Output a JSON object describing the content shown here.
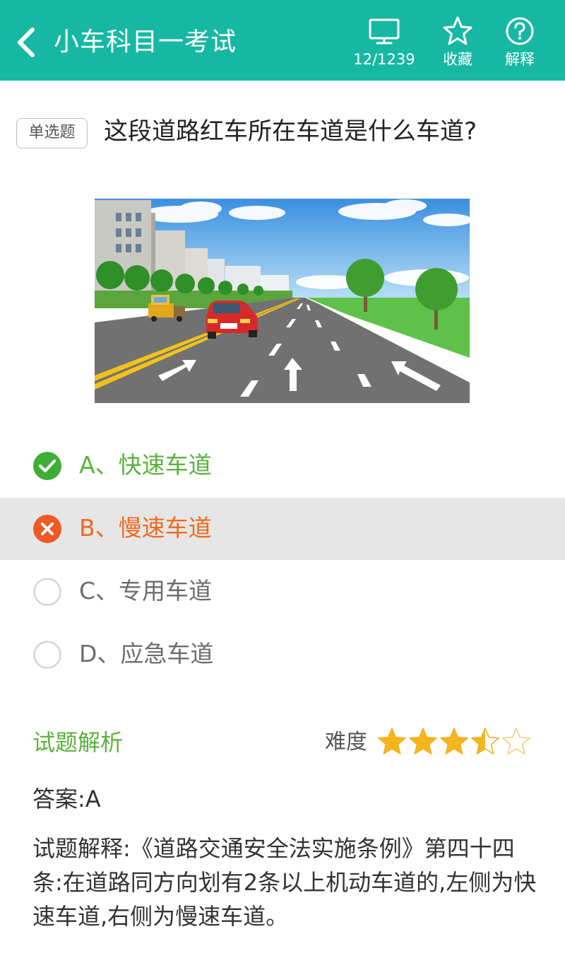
{
  "header": {
    "title": "小车科目一考试",
    "progress": "12/1239",
    "favorite_label": "收藏",
    "explain_label": "解释",
    "background_color": "#17b8a3",
    "icons": [
      "back-arrow-icon",
      "monitor-icon",
      "star-icon",
      "help-icon"
    ]
  },
  "question": {
    "type_badge": "单选题",
    "text": "这段道路红车所在车道是什么车道?"
  },
  "options": [
    {
      "label": "A、快速车道",
      "state": "correct",
      "icon": "check-circle-icon",
      "color": "#59b33b"
    },
    {
      "label": "B、慢速车道",
      "state": "wrong-selected",
      "icon": "x-circle-icon",
      "color": "#ef6a1f"
    },
    {
      "label": "C、专用车道",
      "state": "unselected",
      "icon": "radio-empty-icon",
      "color": "#6d6d6d"
    },
    {
      "label": "D、应急车道",
      "state": "unselected",
      "icon": "radio-empty-icon",
      "color": "#6d6d6d"
    }
  ],
  "analysis": {
    "title": "试题解析",
    "difficulty_label": "难度",
    "difficulty_stars": 3.5,
    "difficulty_max": 5,
    "answer": "答案:A",
    "explanation": "试题解释:《道路交通安全法实施条例》第四十四条:在道路同方向划有2条以上机动车道的,左侧为快速车道,右侧为慢速车道。"
  }
}
